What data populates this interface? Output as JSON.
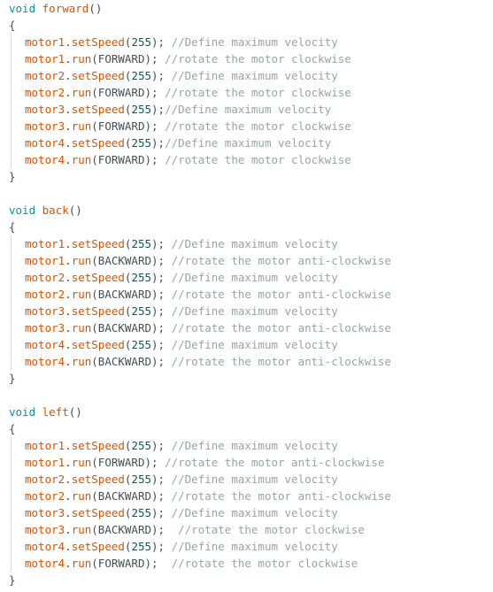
{
  "functions": [
    {
      "keyword": "void",
      "name": "forward",
      "parens": "()",
      "open": "{",
      "close": "}",
      "lines": [
        {
          "obj": "motor1",
          "method": "setSpeed",
          "arg": "255",
          "sep": "); ",
          "comment": "//Define maximum velocity"
        },
        {
          "obj": "motor1",
          "method": "run",
          "arg": "FORWARD",
          "sep": "); ",
          "comment": "//rotate the motor clockwise"
        },
        {
          "obj": "motor2",
          "method": "setSpeed",
          "arg": "255",
          "sep": "); ",
          "comment": "//Define maximum velocity"
        },
        {
          "obj": "motor2",
          "method": "run",
          "arg": "FORWARD",
          "sep": "); ",
          "comment": "//rotate the motor clockwise"
        },
        {
          "obj": "motor3",
          "method": "setSpeed",
          "arg": "255",
          "sep": ");",
          "comment": "//Define maximum velocity"
        },
        {
          "obj": "motor3",
          "method": "run",
          "arg": "FORWARD",
          "sep": "); ",
          "comment": "//rotate the motor clockwise"
        },
        {
          "obj": "motor4",
          "method": "setSpeed",
          "arg": "255",
          "sep": ");",
          "comment": "//Define maximum velocity"
        },
        {
          "obj": "motor4",
          "method": "run",
          "arg": "FORWARD",
          "sep": "); ",
          "comment": "//rotate the motor clockwise"
        }
      ]
    },
    {
      "keyword": "void",
      "name": "back",
      "parens": "()",
      "open": "{",
      "close": "}",
      "lines": [
        {
          "obj": "motor1",
          "method": "setSpeed",
          "arg": "255",
          "sep": "); ",
          "comment": "//Define maximum velocity"
        },
        {
          "obj": "motor1",
          "method": "run",
          "arg": "BACKWARD",
          "sep": "); ",
          "comment": "//rotate the motor anti-clockwise"
        },
        {
          "obj": "motor2",
          "method": "setSpeed",
          "arg": "255",
          "sep": "); ",
          "comment": "//Define maximum velocity"
        },
        {
          "obj": "motor2",
          "method": "run",
          "arg": "BACKWARD",
          "sep": "); ",
          "comment": "//rotate the motor anti-clockwise"
        },
        {
          "obj": "motor3",
          "method": "setSpeed",
          "arg": "255",
          "sep": "); ",
          "comment": "//Define maximum velocity"
        },
        {
          "obj": "motor3",
          "method": "run",
          "arg": "BACKWARD",
          "sep": "); ",
          "comment": "//rotate the motor anti-clockwise"
        },
        {
          "obj": "motor4",
          "method": "setSpeed",
          "arg": "255",
          "sep": "); ",
          "comment": "//Define maximum velocity"
        },
        {
          "obj": "motor4",
          "method": "run",
          "arg": "BACKWARD",
          "sep": "); ",
          "comment": "//rotate the motor anti-clockwise"
        }
      ]
    },
    {
      "keyword": "void",
      "name": "left",
      "parens": "()",
      "open": "{",
      "close": "}",
      "lines": [
        {
          "obj": "motor1",
          "method": "setSpeed",
          "arg": "255",
          "sep": "); ",
          "comment": "//Define maximum velocity"
        },
        {
          "obj": "motor1",
          "method": "run",
          "arg": "FORWARD",
          "sep": "); ",
          "comment": "//rotate the motor anti-clockwise"
        },
        {
          "obj": "motor2",
          "method": "setSpeed",
          "arg": "255",
          "sep": "); ",
          "comment": "//Define maximum velocity"
        },
        {
          "obj": "motor2",
          "method": "run",
          "arg": "BACKWARD",
          "sep": "); ",
          "comment": "//rotate the motor anti-clockwise"
        },
        {
          "obj": "motor3",
          "method": "setSpeed",
          "arg": "255",
          "sep": "); ",
          "comment": "//Define maximum velocity"
        },
        {
          "obj": "motor3",
          "method": "run",
          "arg": "BACKWARD",
          "sep": ");  ",
          "comment": "//rotate the motor clockwise"
        },
        {
          "obj": "motor4",
          "method": "setSpeed",
          "arg": "255",
          "sep": "); ",
          "comment": "//Define maximum velocity"
        },
        {
          "obj": "motor4",
          "method": "run",
          "arg": "FORWARD",
          "sep": ");  ",
          "comment": "//rotate the motor clockwise"
        }
      ]
    }
  ],
  "colors": {
    "keyword": "#00979c",
    "function_name": "#d35400",
    "number": "#005c5f",
    "comment": "#95a5a6",
    "text": "#434f54"
  }
}
